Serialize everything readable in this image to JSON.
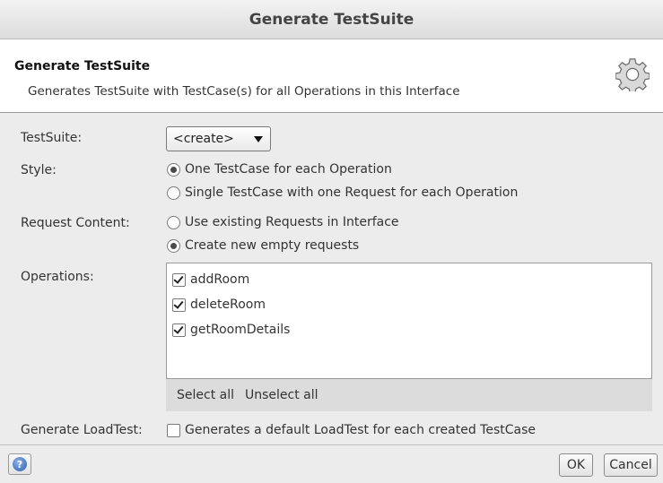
{
  "window": {
    "title": "Generate TestSuite"
  },
  "header": {
    "title": "Generate TestSuite",
    "description": "Generates TestSuite with TestCase(s) for all Operations in this Interface",
    "icon": "gear-icon"
  },
  "form": {
    "testsuite_label": "TestSuite:",
    "testsuite_value": "<create>",
    "style_label": "Style:",
    "style_options": [
      {
        "label": "One TestCase for each Operation",
        "selected": true
      },
      {
        "label": "Single TestCase with one Request for each Operation",
        "selected": false
      }
    ],
    "request_label": "Request Content:",
    "request_options": [
      {
        "label": "Use existing Requests in Interface",
        "selected": false
      },
      {
        "label": "Create new empty requests",
        "selected": true
      }
    ],
    "operations_label": "Operations:",
    "operations": [
      {
        "name": "addRoom",
        "checked": true
      },
      {
        "name": "deleteRoom",
        "checked": true
      },
      {
        "name": "getRoomDetails",
        "checked": true
      }
    ],
    "select_all": "Select all",
    "unselect_all": "Unselect all",
    "loadtest_label": "Generate LoadTest:",
    "loadtest_text": "Generates a default LoadTest for each created TestCase",
    "loadtest_checked": false
  },
  "footer": {
    "help_icon": "help-icon",
    "ok_label": "OK",
    "cancel_label": "Cancel"
  }
}
